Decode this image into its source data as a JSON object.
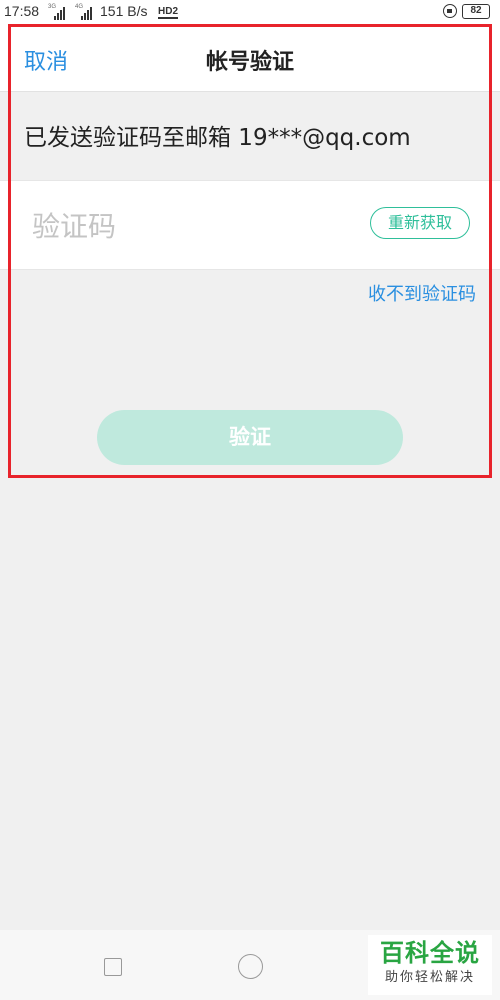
{
  "status_bar": {
    "time": "17:58",
    "net1": "3G",
    "net2": "4G",
    "speed": "151 B/s",
    "hd": "HD2",
    "battery": "82"
  },
  "header": {
    "cancel_label": "取消",
    "title": "帐号验证"
  },
  "info_text": "已发送验证码至邮箱 19***@qq.com",
  "code_input": {
    "placeholder": "验证码",
    "value": ""
  },
  "resend_label": "重新获取",
  "no_code_link": "收不到验证码",
  "verify_label": "验证",
  "watermark": {
    "main": "百科全说",
    "sub": "助你轻松解决"
  },
  "colors": {
    "link_blue": "#2a8fe0",
    "accent_green": "#2fbf9a",
    "verify_disabled": "#bfe9dd",
    "highlight_red": "#e8232b"
  },
  "icons": [
    "lock-icon",
    "battery-icon",
    "signal-icon",
    "nav-recent-icon",
    "nav-home-icon"
  ]
}
